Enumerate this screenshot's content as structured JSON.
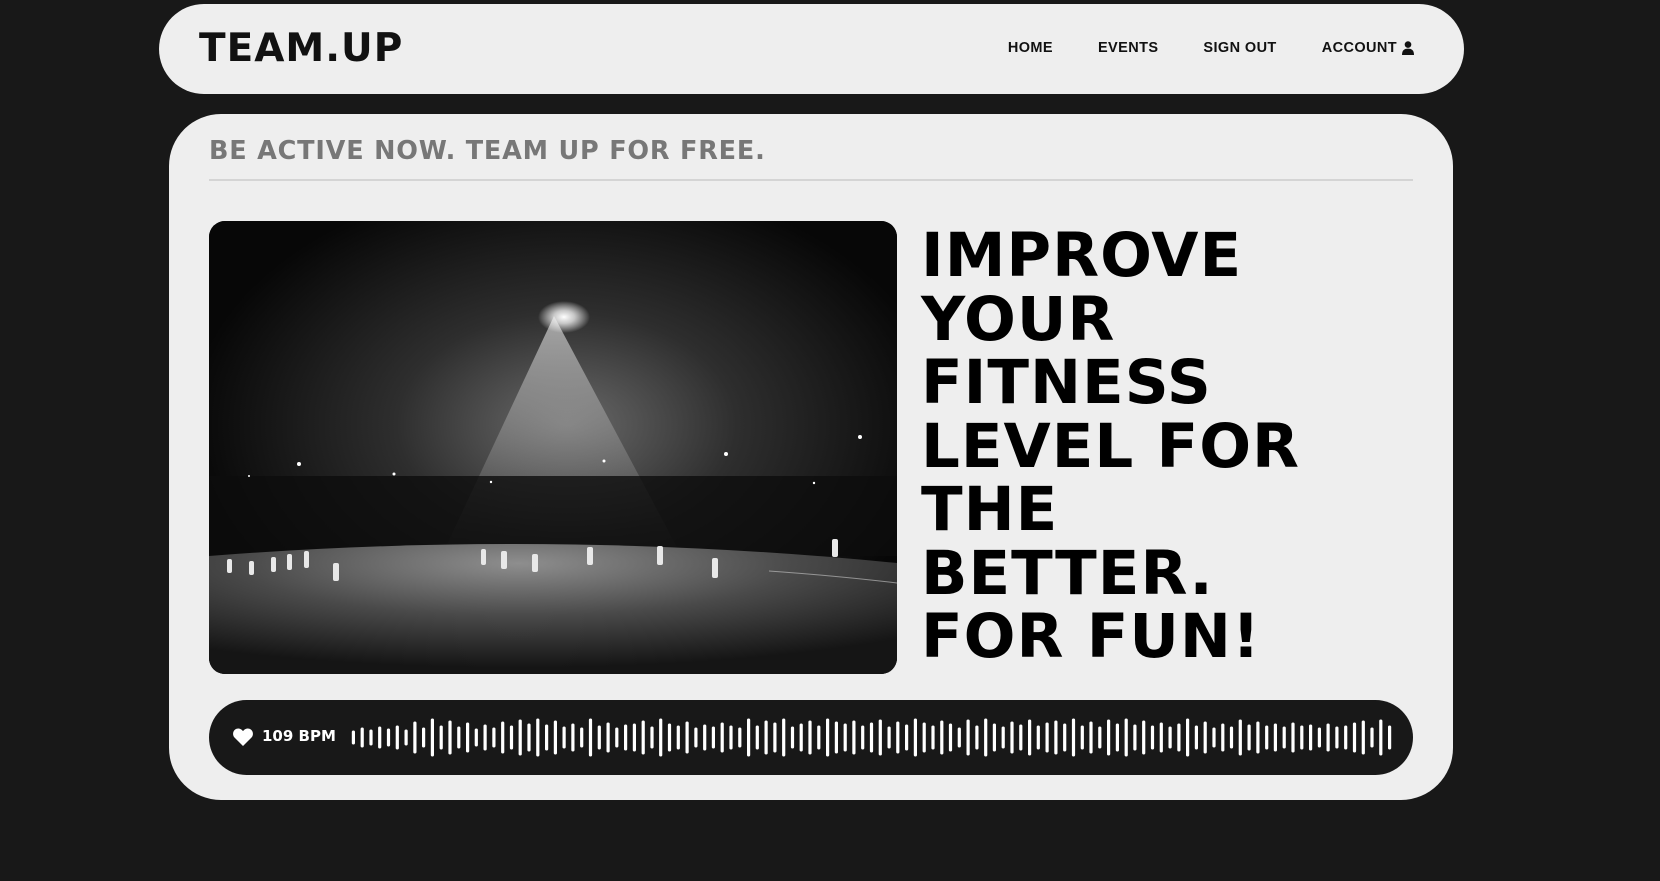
{
  "nav": {
    "logo": "TEAM.UP",
    "links": [
      {
        "label": "HOME"
      },
      {
        "label": "EVENTS"
      },
      {
        "label": "SIGN OUT"
      },
      {
        "label": "ACCOUNT",
        "icon": "user-icon"
      }
    ]
  },
  "hero": {
    "tagline": "BE ACTIVE NOW. TEAM UP FOR FREE.",
    "headline": "IMPROVE\nYOUR\nFITNESS\nLEVEL FOR\nTHE\nBETTER.\nFOR FUN!",
    "image": {
      "icon": "night-soccer-photo"
    }
  },
  "heart_rate": {
    "icon": "heart-icon",
    "label": "109 BPM",
    "wave_levels": [
      0.35,
      0.5,
      0.4,
      0.55,
      0.45,
      0.6,
      0.4,
      0.8,
      0.5,
      0.95,
      0.6,
      0.85,
      0.55,
      0.75,
      0.45,
      0.65,
      0.5,
      0.8,
      0.6,
      0.9,
      0.7,
      0.95,
      0.65,
      0.85,
      0.55,
      0.7,
      0.5,
      0.95,
      0.6,
      0.75,
      0.5,
      0.65,
      0.7,
      0.85,
      0.55,
      0.95,
      0.7,
      0.6,
      0.8,
      0.5,
      0.65,
      0.55,
      0.75,
      0.6,
      0.5,
      0.95,
      0.6,
      0.85,
      0.75,
      0.95,
      0.55,
      0.7,
      0.85,
      0.6,
      0.95,
      0.8,
      0.7,
      0.85,
      0.6,
      0.75,
      0.9,
      0.55,
      0.8,
      0.65,
      0.95,
      0.75,
      0.6,
      0.85,
      0.7,
      0.5,
      0.9,
      0.6,
      0.95,
      0.7,
      0.55,
      0.8,
      0.65,
      0.9,
      0.6,
      0.75,
      0.85,
      0.7,
      0.95,
      0.6,
      0.8,
      0.55,
      0.9,
      0.7,
      0.95,
      0.65,
      0.85,
      0.6,
      0.75,
      0.55,
      0.7,
      0.95,
      0.6,
      0.8,
      0.5,
      0.7,
      0.55,
      0.9,
      0.65,
      0.8,
      0.6,
      0.7,
      0.55,
      0.75,
      0.6,
      0.65,
      0.5,
      0.7,
      0.55,
      0.6,
      0.75,
      0.85,
      0.5,
      0.9,
      0.6
    ],
    "colors": {
      "bar_bg": "#181818",
      "wave": "#ffffff"
    }
  },
  "colors": {
    "page_bg": "#181818",
    "card_bg": "#eeeeee",
    "text": "#000000",
    "tagline": "#777777"
  }
}
